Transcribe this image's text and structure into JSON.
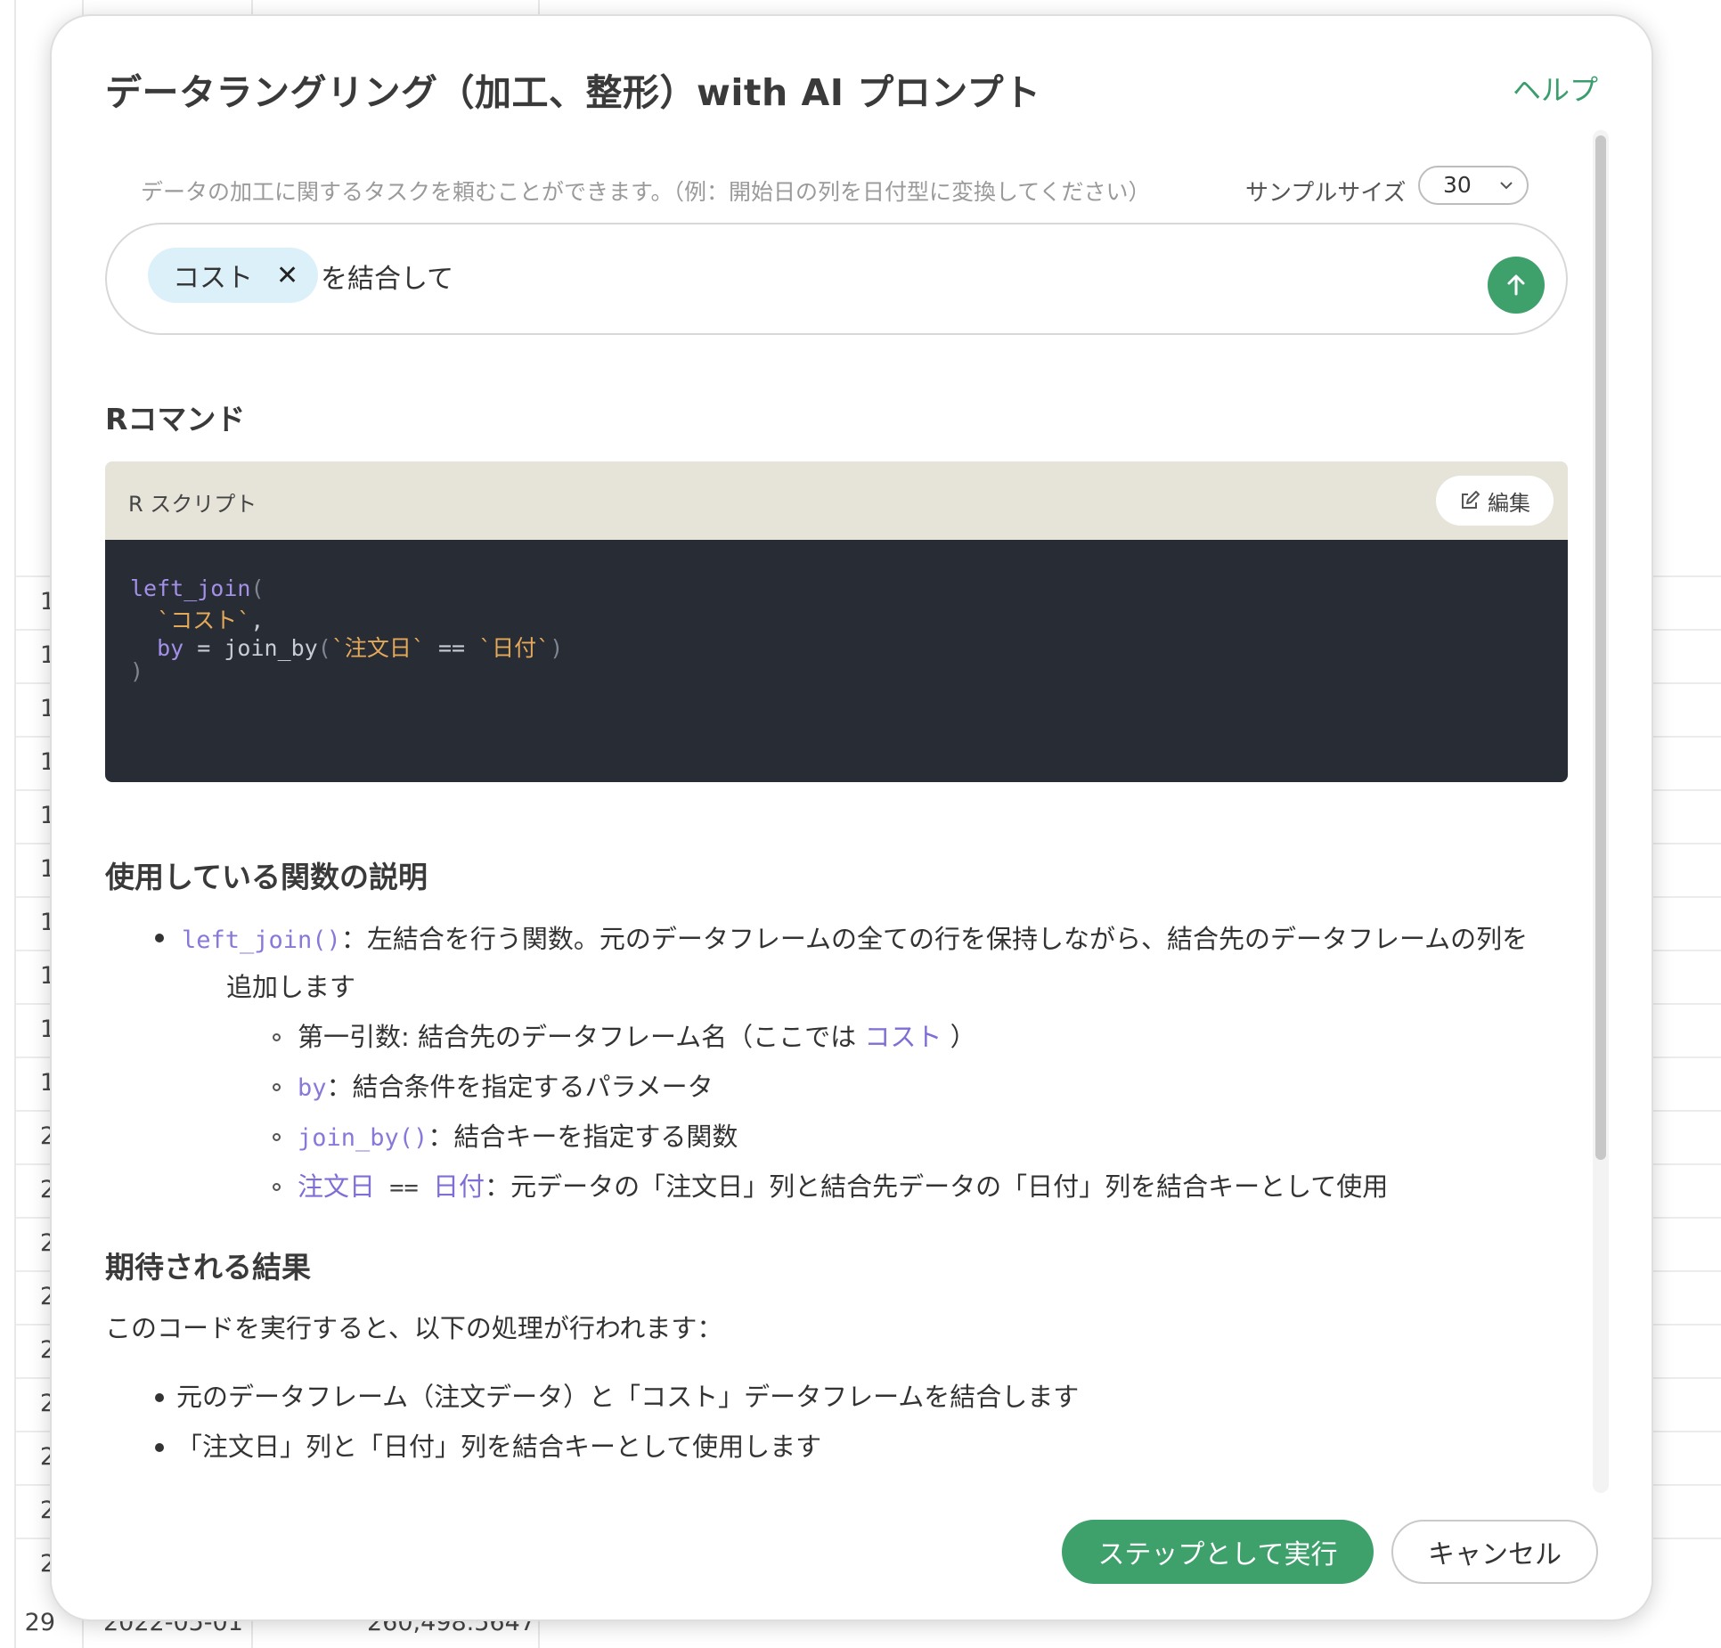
{
  "background": {
    "row_numbers": [
      "1",
      "1",
      "1",
      "1",
      "1",
      "1",
      "1",
      "1",
      "1",
      "1",
      "2",
      "2",
      "2",
      "2",
      "2",
      "2",
      "2",
      "2",
      "2",
      "29"
    ],
    "last_row": {
      "date": "2022-05-01",
      "value": "260,498.5647"
    }
  },
  "modal": {
    "title": "データラングリング（加工、整形）with AI プロンプト",
    "help_link": "ヘルプ",
    "hint": "データの加工に関するタスクを頼むことができます。（例：開始日の列を日付型に変換してください）",
    "sample_size": {
      "label": "サンプルサイズ",
      "value": "30"
    },
    "prompt": {
      "chip_label": "コスト",
      "text": "を結合して"
    },
    "r_command": {
      "heading": "Rコマンド",
      "card_label": "R スクリプト",
      "edit_label": "編集",
      "code": {
        "line1_fn": "left_join",
        "line1_punc": "(",
        "line2_str": "`コスト`",
        "line2_punc": ",",
        "line3_arg": "by",
        "line3_eq": " = join_by",
        "line3_open": "(",
        "line3_str1": "`注文日`",
        "line3_op": " == ",
        "line3_str2": "`日付`",
        "line3_close": ")",
        "line4_punc": ")"
      }
    },
    "functions": {
      "heading": "使用している関数の説明",
      "b1_code": "left_join()",
      "b1_text": "：左結合を行う関数。元のデータフレームの全ての行を保持しながら、結合先のデータフレームの列を",
      "b1_text_cont": "追加します",
      "s1_text": "第一引数: 結合先のデータフレーム名（ここでは ",
      "s1_link": "コスト",
      "s1_end": " ）",
      "s2_code": "by",
      "s2_text": "：結合条件を指定するパラメータ",
      "s3_code": "join_by()",
      "s3_text": "：結合キーを指定する関数",
      "s4_a": "注文日",
      "s4_op": " == ",
      "s4_b": "日付",
      "s4_text": "：元データの「注文日」列と結合先データの「日付」列を結合キーとして使用"
    },
    "results": {
      "heading": "期待される結果",
      "intro": "このコードを実行すると、以下の処理が行われます：",
      "items": [
        "元のデータフレーム（注文データ）と「コスト」データフレームを結合します",
        "「注文日」列と「日付」列を結合キーとして使用します"
      ]
    },
    "buttons": {
      "run": "ステップとして実行",
      "cancel": "キャンセル"
    }
  },
  "colors": {
    "accent_green": "#3ea06b",
    "chip_bg": "#dcf0fa",
    "code_bg": "#282c34",
    "code_header_bg": "#e6e4d9",
    "function_purple": "#8878d8",
    "string_orange": "#e5a95a"
  }
}
